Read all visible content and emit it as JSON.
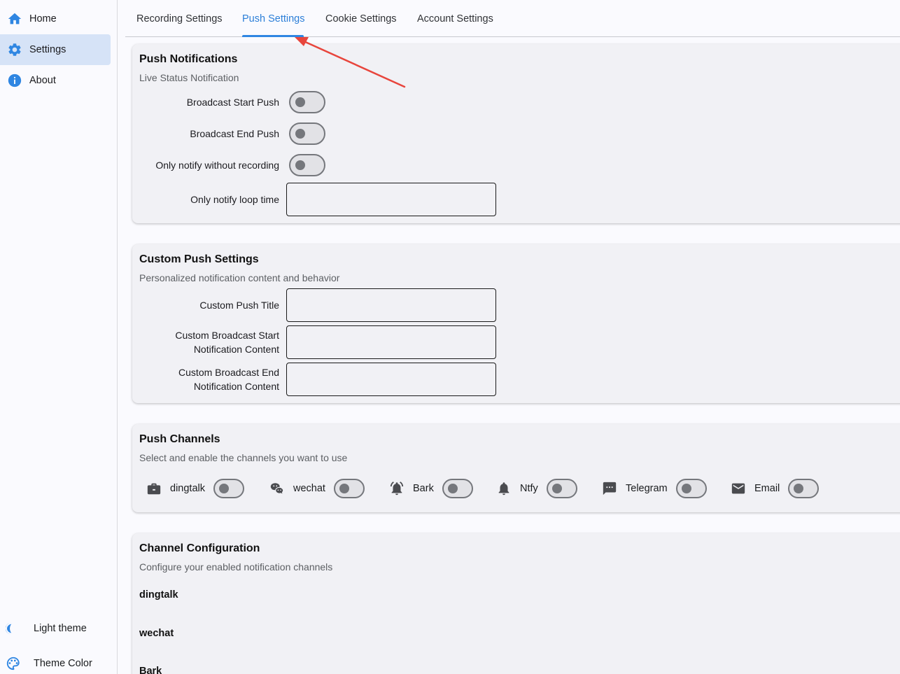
{
  "sidebar": {
    "items": [
      {
        "label": "Home",
        "icon": "home-icon"
      },
      {
        "label": "Settings",
        "icon": "gear-icon"
      },
      {
        "label": "About",
        "icon": "info-icon"
      }
    ],
    "bottom": [
      {
        "label": "Light theme",
        "icon": "moon-icon"
      },
      {
        "label": "Theme Color",
        "icon": "palette-icon"
      }
    ]
  },
  "tabs": [
    {
      "label": "Recording Settings"
    },
    {
      "label": "Push Settings"
    },
    {
      "label": "Cookie Settings"
    },
    {
      "label": "Account Settings"
    }
  ],
  "push_notifications": {
    "title": "Push Notifications",
    "subtitle": "Live Status Notification",
    "rows": [
      {
        "label": "Broadcast Start Push",
        "on": false
      },
      {
        "label": "Broadcast End Push",
        "on": false
      },
      {
        "label": "Only notify without recording",
        "on": false
      }
    ],
    "loop_time_label": "Only notify loop time",
    "loop_time_value": ""
  },
  "custom_push": {
    "title": "Custom Push Settings",
    "subtitle": "Personalized notification content and behavior",
    "fields": [
      {
        "label": "Custom Push Title",
        "value": ""
      },
      {
        "label": "Custom Broadcast Start\nNotification Content",
        "value": ""
      },
      {
        "label": "Custom Broadcast End\nNotification Content",
        "value": ""
      }
    ]
  },
  "push_channels": {
    "title": "Push Channels",
    "subtitle": "Select and enable the channels you want to use",
    "channels": [
      {
        "label": "dingtalk",
        "icon": "briefcase-icon",
        "on": false
      },
      {
        "label": "wechat",
        "icon": "wechat-icon",
        "on": false
      },
      {
        "label": "Bark",
        "icon": "bell-ring-icon",
        "on": false
      },
      {
        "label": "Ntfy",
        "icon": "bell-icon",
        "on": false
      },
      {
        "label": "Telegram",
        "icon": "chat-icon",
        "on": false
      },
      {
        "label": "Email",
        "icon": "mail-icon",
        "on": false
      }
    ]
  },
  "channel_config": {
    "title": "Channel Configuration",
    "subtitle": "Configure your enabled notification channels",
    "items": [
      "dingtalk",
      "wechat",
      "Bark"
    ]
  },
  "colors": {
    "accent": "#2c7fd8",
    "annotation_arrow": "#e8453c",
    "selected_nav_bg": "#d6e3f7"
  }
}
